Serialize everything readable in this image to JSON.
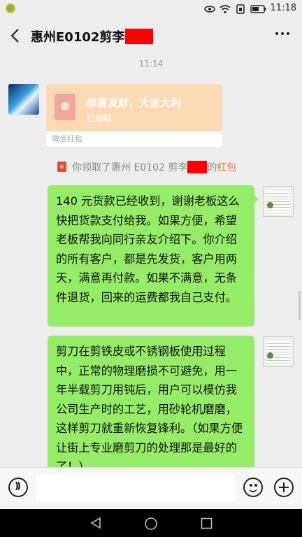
{
  "status_bar": {
    "time": "11:18",
    "icons": [
      "eye-icon",
      "wifi-icon",
      "sim-icon",
      "battery-icon"
    ]
  },
  "header": {
    "title": "惠州E0102剪李",
    "back_icon": "chevron-left-icon",
    "more_icon": "more-icon"
  },
  "chat": {
    "timestamp": "11:14",
    "red_packet": {
      "greeting": "恭喜发财，大吉大利",
      "status": "已领取",
      "footer": "微信红包"
    },
    "system_message": {
      "prefix": "你领取了惠州 E0102 剪李",
      "suffix": "的",
      "link": "红包"
    },
    "messages": [
      {
        "sender": "me",
        "text": "140 元货款已经收到，谢谢老板这么快把货款支付给我。如果方便，希望老板帮我向同行亲友介绍下。你介绍的所有客户，都是先发货，客户用两天，满意再付款。如果不满意，无条件退货，回来的运费都我自己支付。"
      },
      {
        "sender": "me",
        "text": "剪刀在剪铁皮或不锈钢板使用过程中，正常的物理磨损不可避免，用一年半载剪刀用钝后，用户可以模仿我公司生产时的工艺，用砂轮机磨磨，这样剪刀就重新恢复锋利。（如果方便让街上专业磨剪刀的处理那是最好的了！）"
      }
    ]
  },
  "colors": {
    "bubble_me": "#95ec69",
    "background": "#ededed",
    "red_packet": "#fbd9b3",
    "redaction": "#ff0000",
    "link": "#e07a2c"
  },
  "input_bar": {
    "voice_icon": "voice-icon",
    "emoji_icon": "emoji-icon",
    "plus_icon": "plus-icon"
  },
  "nav_bar": {
    "icons": [
      "nav-back-icon",
      "nav-home-icon",
      "nav-recent-icon"
    ]
  }
}
